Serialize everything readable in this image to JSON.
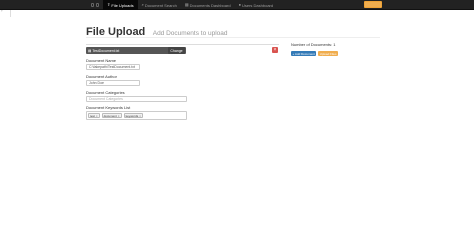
{
  "navbar": {
    "items": [
      {
        "label": "File Uploads",
        "icon": "upload-icon",
        "active": true
      },
      {
        "label": "Document Search",
        "icon": "search-icon",
        "active": false
      },
      {
        "label": "Documents Dashboard",
        "icon": "dashboard-icon",
        "active": false
      },
      {
        "label": "Users Dashboard",
        "icon": "user-icon",
        "active": false
      }
    ],
    "icons": {
      "upload": "⇪",
      "search": "⌕",
      "dashboard": "▦",
      "user": "●"
    }
  },
  "header": {
    "title": "File Upload",
    "subtitle": "Add Documents to upload"
  },
  "file_input": {
    "filename": "TestDocument.txt",
    "file_icon": "▤",
    "change_label": "Change",
    "remove_label": "×"
  },
  "form": {
    "doc_name_label": "Document Name",
    "doc_name_value": "C:\\fakepath\\TestDocument.txt",
    "doc_author_label": "Document Author",
    "doc_author_value": "John Doe",
    "doc_categories_label": "Document Categories",
    "doc_categories_placeholder": "Document Categories",
    "doc_keywords_label": "Document Keywords List",
    "keywords": [
      "test",
      "document",
      "keywords"
    ],
    "tag_remove": "×"
  },
  "right_panel": {
    "doc_count": "Number of Documents: 1",
    "add_button": "+ Add Document",
    "upload_button": "Upload Files"
  },
  "colors": {
    "navbar": "#222222",
    "primary": "#337ab7",
    "warning": "#f0ad4e",
    "danger": "#d9534f"
  }
}
